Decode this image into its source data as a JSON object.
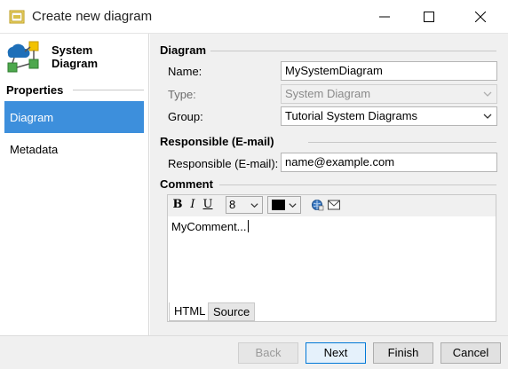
{
  "window": {
    "title": "Create new diagram"
  },
  "sidebar": {
    "diagram_type": "System Diagram",
    "properties_heading": "Properties",
    "items": [
      {
        "label": "Diagram",
        "selected": true
      },
      {
        "label": "Metadata",
        "selected": false
      }
    ]
  },
  "diagram_section": {
    "heading": "Diagram",
    "name_label": "Name:",
    "name_value": "MySystemDiagram",
    "type_label": "Type:",
    "type_value": "System Diagram",
    "group_label": "Group:",
    "group_value": "Tutorial System Diagrams"
  },
  "responsible_section": {
    "heading": "Responsible (E-mail)",
    "label": "Responsible (E-mail):",
    "value": "name@example.com"
  },
  "comment_section": {
    "heading": "Comment",
    "toolbar": {
      "bold": "B",
      "italic": "I",
      "underline": "U",
      "font_size": "8",
      "color": "#000000"
    },
    "text": "MyComment...",
    "tabs": [
      "HTML",
      "Source"
    ]
  },
  "footer": {
    "back": "Back",
    "next": "Next",
    "finish": "Finish",
    "cancel": "Cancel"
  },
  "icons": {
    "app": "dialog-icon",
    "diagram_type": "system-diagram-icon",
    "minimize": "minimize-icon",
    "maximize": "maximize-icon",
    "close": "close-icon"
  },
  "colors": {
    "selection": "#3d8fdc",
    "default_button_border": "#0078d7"
  }
}
